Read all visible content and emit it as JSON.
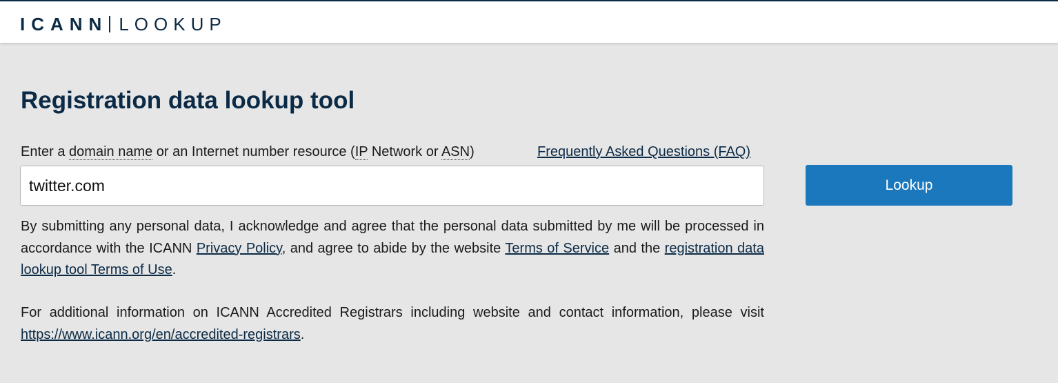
{
  "header": {
    "logo_strong": "ICANN",
    "logo_light": "LOOKUP"
  },
  "main": {
    "title": "Registration data lookup tool",
    "prompt": {
      "prefix": "Enter a ",
      "domain_name": "domain name",
      "middle": " or an Internet number resource (",
      "ip": "IP",
      "network_or": " Network or ",
      "asn": "ASN",
      "suffix": ")"
    },
    "faq_link": "Frequently Asked Questions (FAQ)",
    "search": {
      "value": "twitter.com",
      "placeholder": ""
    },
    "lookup_button": "Lookup",
    "consent": {
      "text_1": "By submitting any personal data, I acknowledge and agree that the personal data submitted by me will be processed in accordance with the ICANN ",
      "privacy_policy": "Privacy Policy",
      "text_2": ", and agree to abide by the website ",
      "terms_of_service": "Terms of Service",
      "text_3": " and the ",
      "terms_of_use": "registration data lookup tool Terms of Use",
      "text_4": "."
    },
    "info": {
      "text_1": "For additional information on ICANN Accredited Registrars including website and contact information, please visit ",
      "registrars_link": "https://www.icann.org/en/accredited-registrars",
      "text_2": "."
    }
  },
  "colors": {
    "brand_navy": "#0b2a45",
    "button_blue": "#1b78bd",
    "page_background": "#e6e6e6"
  }
}
